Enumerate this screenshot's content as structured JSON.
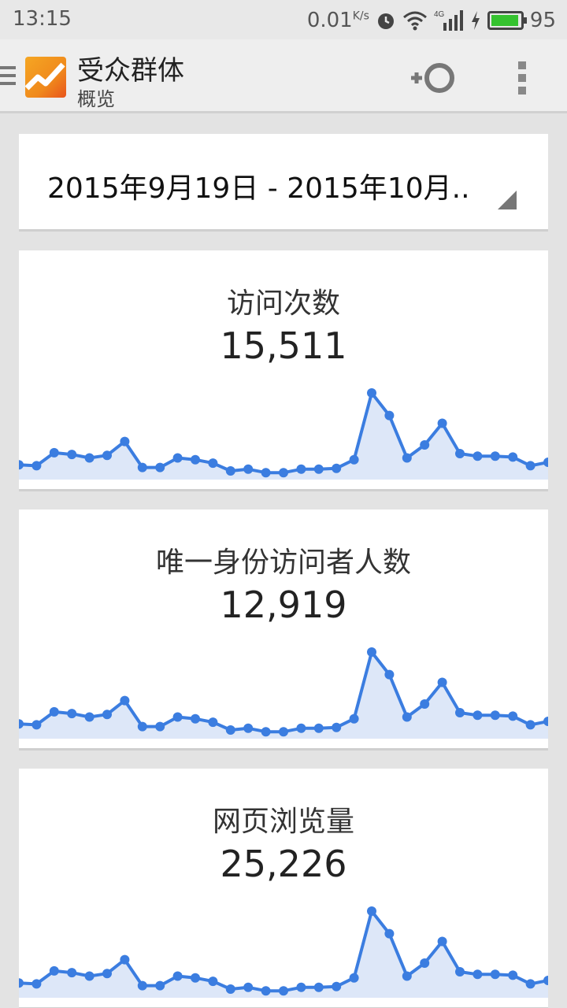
{
  "status_bar": {
    "time": "13:15",
    "network_speed": "0.01",
    "network_speed_unit": "K/s",
    "network_type": "4G",
    "battery_level": "95",
    "battery_color": "#35c22f"
  },
  "app_bar": {
    "title": "受众群体",
    "subtitle": "概览",
    "icons": [
      "menu-icon",
      "analytics-logo",
      "segment-icon",
      "overflow-menu-icon"
    ]
  },
  "date_range": {
    "label": "2015年9月19日 - 2015年10月.."
  },
  "accent_color": "#3b7de0",
  "metrics": [
    {
      "label": "访问次数",
      "value": "15,511",
      "trend": [
        0.17,
        0.16,
        0.31,
        0.29,
        0.25,
        0.28,
        0.44,
        0.14,
        0.14,
        0.25,
        0.23,
        0.19,
        0.1,
        0.12,
        0.08,
        0.08,
        0.12,
        0.12,
        0.13,
        0.23,
        1.0,
        0.74,
        0.25,
        0.4,
        0.65,
        0.3,
        0.27,
        0.27,
        0.26,
        0.16,
        0.2
      ]
    },
    {
      "label": "唯一身份访问者人数",
      "value": "12,919",
      "trend": [
        0.17,
        0.16,
        0.31,
        0.29,
        0.25,
        0.28,
        0.44,
        0.14,
        0.14,
        0.25,
        0.23,
        0.19,
        0.1,
        0.12,
        0.08,
        0.08,
        0.12,
        0.12,
        0.13,
        0.23,
        1.0,
        0.74,
        0.25,
        0.4,
        0.65,
        0.3,
        0.27,
        0.27,
        0.26,
        0.16,
        0.2
      ]
    },
    {
      "label": "网页浏览量",
      "value": "25,226",
      "trend": [
        0.17,
        0.16,
        0.31,
        0.29,
        0.25,
        0.28,
        0.44,
        0.14,
        0.14,
        0.25,
        0.23,
        0.19,
        0.1,
        0.12,
        0.08,
        0.08,
        0.12,
        0.12,
        0.13,
        0.23,
        1.0,
        0.74,
        0.25,
        0.4,
        0.65,
        0.3,
        0.27,
        0.27,
        0.26,
        0.16,
        0.2
      ]
    }
  ]
}
